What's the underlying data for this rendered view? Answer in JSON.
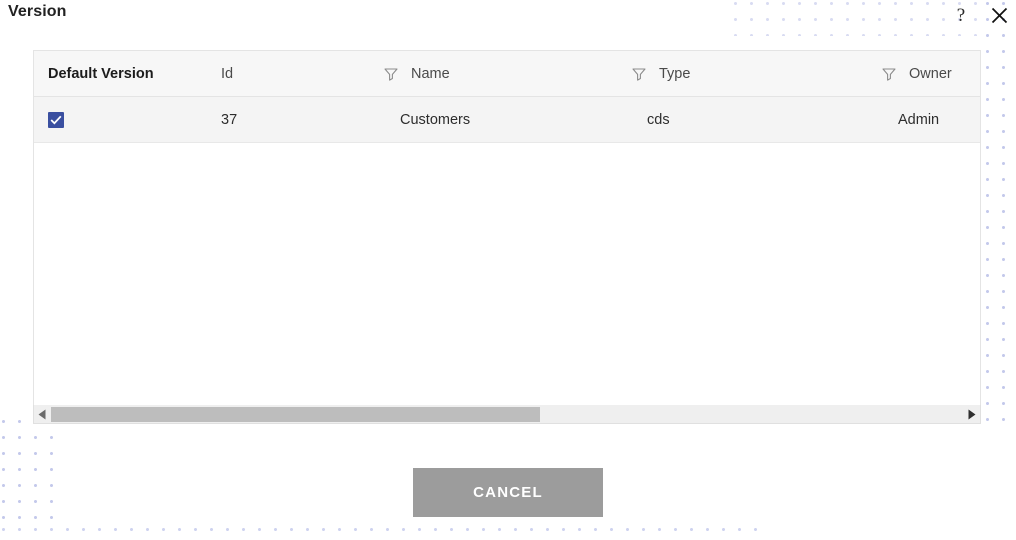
{
  "dialog": {
    "title": "Version",
    "help_icon": "question-mark-icon",
    "close_icon": "close-icon"
  },
  "table": {
    "columns": [
      {
        "label": "Default Version",
        "has_filter": false,
        "bold": true
      },
      {
        "label": "Id",
        "has_filter": true,
        "bold": false
      },
      {
        "label": "Name",
        "has_filter": true,
        "bold": false
      },
      {
        "label": "Type",
        "has_filter": true,
        "bold": false
      },
      {
        "label": "Owner",
        "has_filter": true,
        "bold": false
      }
    ],
    "rows": [
      {
        "default_version_checked": true,
        "id": "37",
        "name": "Customers",
        "type": "cds",
        "owner": "Admin"
      }
    ]
  },
  "scrollbar": {
    "left_arrow": "triangle-left-icon",
    "right_arrow": "triangle-right-icon"
  },
  "footer": {
    "cancel_label": "CANCEL"
  },
  "colors": {
    "checkbox_blue": "#3a4fa0",
    "cancel_grey": "#9c9c9c",
    "row_grey": "#f4f4f4",
    "header_grey": "#f7f7f7",
    "dot_pattern": "#b9c0e8"
  }
}
